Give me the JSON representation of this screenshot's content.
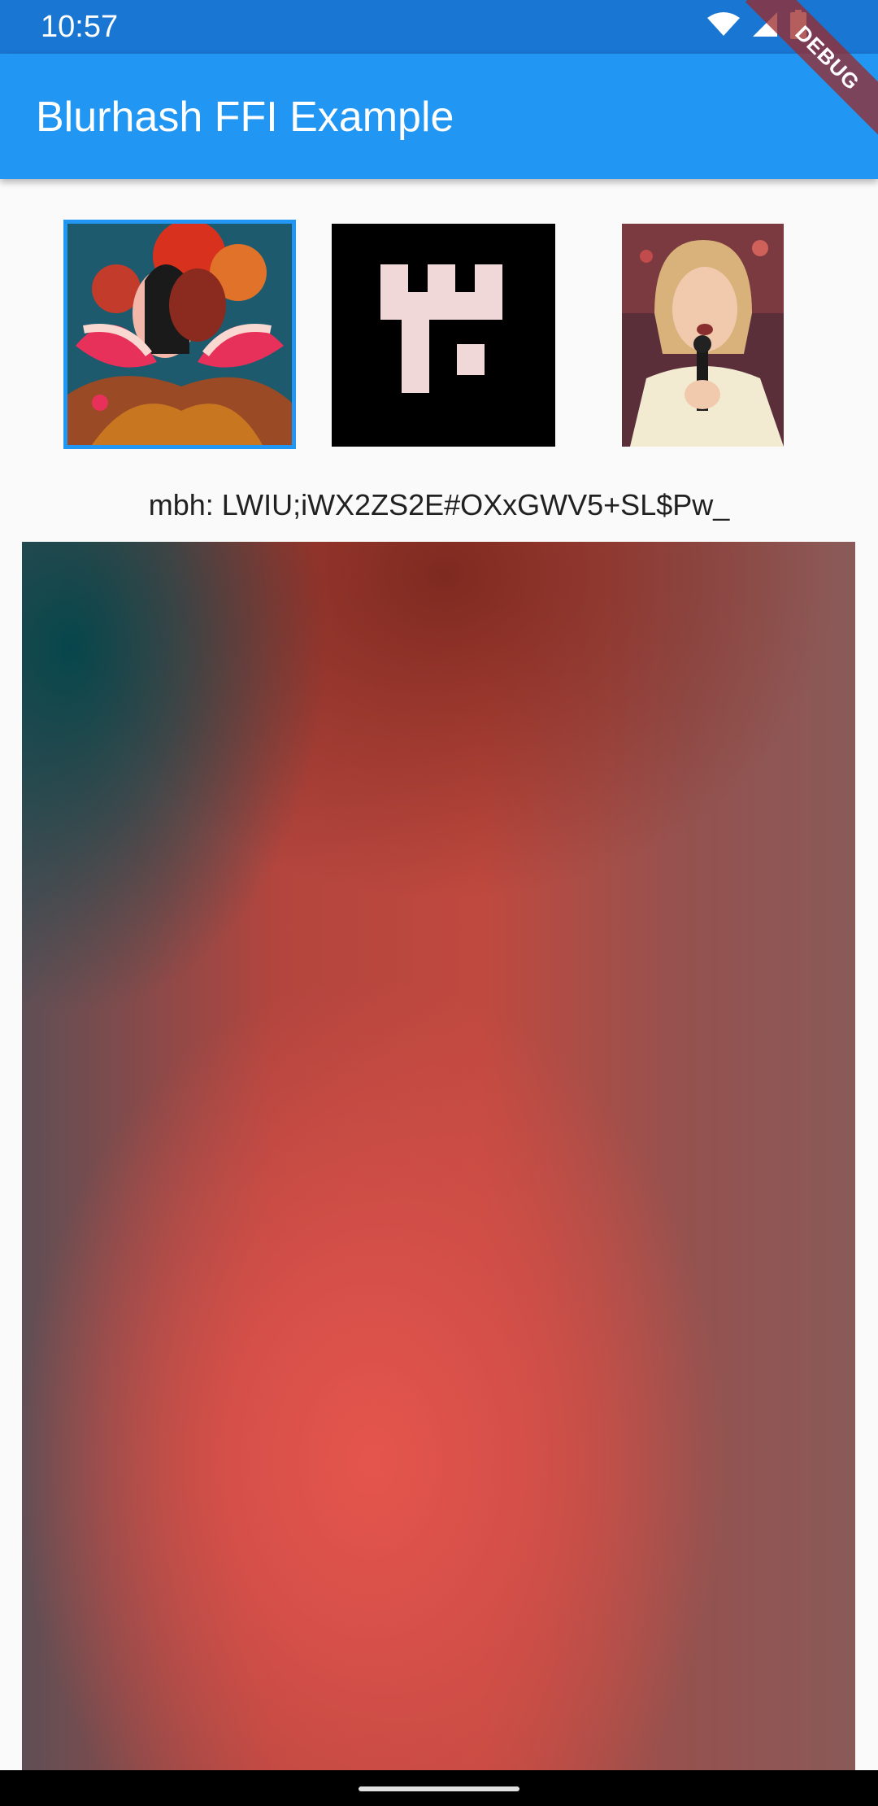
{
  "status_bar": {
    "time": "10:57",
    "icons": [
      "wifi-icon",
      "signal-icon",
      "battery-icon"
    ],
    "color": "#1976d2"
  },
  "app_bar": {
    "title": "Blurhash FFI Example",
    "color": "#2196f3"
  },
  "debug_banner": {
    "label": "DEBUG"
  },
  "thumbnails": [
    {
      "name": "illustration-thumbnail",
      "selected": true
    },
    {
      "name": "pixel-glyph-thumbnail",
      "selected": false
    },
    {
      "name": "portrait-photo-thumbnail",
      "selected": false
    }
  ],
  "hash": {
    "label": "mbh: LWIU;iWX2ZS2E#OXxGWV5+SL$Pw_"
  },
  "colors": {
    "accent": "#2196f3",
    "selection_border": "#2196f3",
    "background": "#fafafa"
  }
}
